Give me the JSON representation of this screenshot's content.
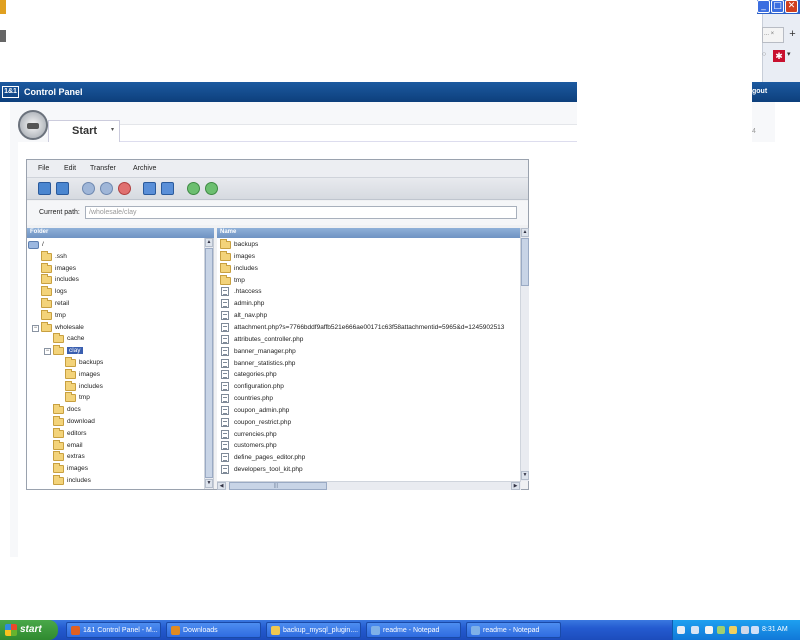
{
  "window": {
    "minimize": "_",
    "maximize": "□",
    "close": "✕"
  },
  "browser": {
    "tab_fragment": "... ×",
    "new_tab": "+",
    "menu_caret": "▾",
    "addon_icon": "✱",
    "misc": "○"
  },
  "header": {
    "logo": "1&1",
    "title": "Control Panel",
    "logout": "gout"
  },
  "start": {
    "label": "Start",
    "caret": "▾",
    "ghost": "4"
  },
  "file_manager": {
    "menu": [
      "File",
      "Edit",
      "Transfer",
      "Archive"
    ],
    "path_label": "Current path:",
    "path_placeholder": "/wholesale/clay",
    "folder_header": "Folder",
    "name_header": "Name",
    "tree": [
      {
        "label": "/",
        "depth": 0,
        "icon": "network-drive-icon",
        "expander": ""
      },
      {
        "label": ".ssh",
        "depth": 1,
        "icon": "folder-icon",
        "expander": ""
      },
      {
        "label": "images",
        "depth": 1,
        "icon": "folder-icon",
        "expander": ""
      },
      {
        "label": "includes",
        "depth": 1,
        "icon": "folder-icon",
        "expander": ""
      },
      {
        "label": "logs",
        "depth": 1,
        "icon": "folder-icon",
        "expander": ""
      },
      {
        "label": "retail",
        "depth": 1,
        "icon": "folder-icon",
        "expander": ""
      },
      {
        "label": "tmp",
        "depth": 1,
        "icon": "folder-icon",
        "expander": ""
      },
      {
        "label": "wholesale",
        "depth": 1,
        "icon": "folder-icon",
        "expander": "−"
      },
      {
        "label": "cache",
        "depth": 2,
        "icon": "folder-icon",
        "expander": ""
      },
      {
        "label": "clay",
        "depth": 2,
        "icon": "folder-icon",
        "expander": "−",
        "selected": true
      },
      {
        "label": "backups",
        "depth": 3,
        "icon": "folder-icon",
        "expander": ""
      },
      {
        "label": "images",
        "depth": 3,
        "icon": "folder-icon",
        "expander": ""
      },
      {
        "label": "includes",
        "depth": 3,
        "icon": "folder-icon",
        "expander": ""
      },
      {
        "label": "tmp",
        "depth": 3,
        "icon": "folder-icon",
        "expander": ""
      },
      {
        "label": "docs",
        "depth": 2,
        "icon": "folder-icon",
        "expander": ""
      },
      {
        "label": "download",
        "depth": 2,
        "icon": "folder-icon",
        "expander": ""
      },
      {
        "label": "editors",
        "depth": 2,
        "icon": "folder-icon",
        "expander": ""
      },
      {
        "label": "email",
        "depth": 2,
        "icon": "folder-icon",
        "expander": ""
      },
      {
        "label": "extras",
        "depth": 2,
        "icon": "folder-icon",
        "expander": ""
      },
      {
        "label": "images",
        "depth": 2,
        "icon": "folder-icon",
        "expander": ""
      },
      {
        "label": "includes",
        "depth": 2,
        "icon": "folder-icon",
        "expander": ""
      }
    ],
    "files": [
      {
        "name": "backups",
        "type": "folder"
      },
      {
        "name": "images",
        "type": "folder"
      },
      {
        "name": "includes",
        "type": "folder"
      },
      {
        "name": "tmp",
        "type": "folder"
      },
      {
        "name": ".htaccess",
        "type": "file"
      },
      {
        "name": "admin.php",
        "type": "file"
      },
      {
        "name": "alt_nav.php",
        "type": "file"
      },
      {
        "name": "attachment.php?s=7766bddf9affb521e666ae00171c63f58attachmentid=5965&d=1245902513",
        "type": "file"
      },
      {
        "name": "attributes_controller.php",
        "type": "file"
      },
      {
        "name": "banner_manager.php",
        "type": "file"
      },
      {
        "name": "banner_statistics.php",
        "type": "file"
      },
      {
        "name": "categories.php",
        "type": "file"
      },
      {
        "name": "configuration.php",
        "type": "file"
      },
      {
        "name": "countries.php",
        "type": "file"
      },
      {
        "name": "coupon_admin.php",
        "type": "file"
      },
      {
        "name": "coupon_restrict.php",
        "type": "file"
      },
      {
        "name": "currencies.php",
        "type": "file"
      },
      {
        "name": "customers.php",
        "type": "file"
      },
      {
        "name": "define_pages_editor.php",
        "type": "file"
      },
      {
        "name": "developers_tool_kit.php",
        "type": "file"
      }
    ],
    "scroll": {
      "up": "▲",
      "down": "▼",
      "left": "◀",
      "right": "▶",
      "grip": "|||"
    }
  },
  "taskbar": {
    "start": "start",
    "tasks": [
      {
        "label": "1&1 Control Panel - M...",
        "color": "#e06020"
      },
      {
        "label": "Downloads",
        "color": "#e08a20"
      },
      {
        "label": "backup_mysql_plugin....",
        "color": "#f0c850"
      },
      {
        "label": "readme - Notepad",
        "color": "#7fb0e8"
      },
      {
        "label": "readme - Notepad",
        "color": "#7fb0e8"
      }
    ],
    "clock": "8:31 AM"
  }
}
